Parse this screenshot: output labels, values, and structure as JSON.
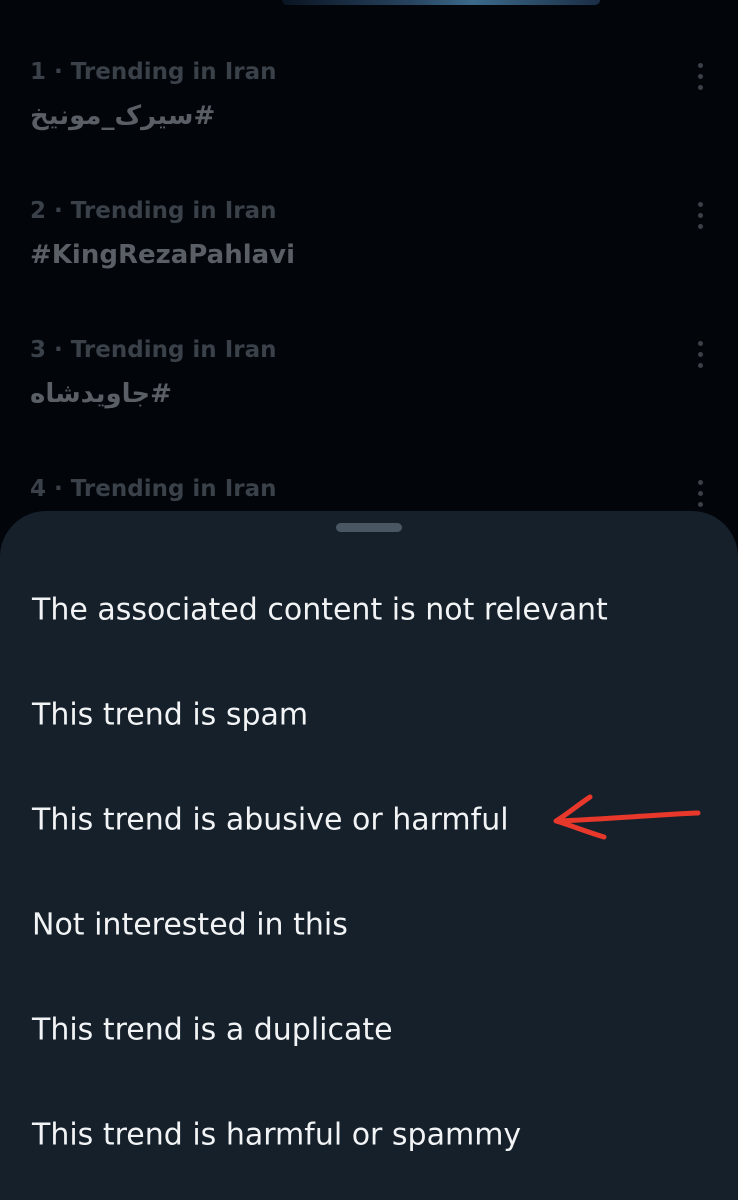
{
  "trends": [
    {
      "meta": "1 · Trending in Iran",
      "name": "#سیرک_مونیخ"
    },
    {
      "meta": "2 · Trending in Iran",
      "name": "#KingRezaPahlavi"
    },
    {
      "meta": "3 · Trending in Iran",
      "name": "#جاویدشاه"
    },
    {
      "meta": "4 · Trending in Iran",
      "name": ""
    }
  ],
  "sheet": {
    "options": [
      "The associated content is not relevant",
      "This trend is spam",
      "This trend is abusive or harmful",
      "Not interested in this",
      "This trend is a duplicate",
      "This trend is harmful or spammy"
    ]
  },
  "annotation": {
    "color": "#e8382b",
    "points_to": "This trend is abusive or harmful"
  },
  "icons": {
    "more": "more-vertical-icon",
    "grabber": "drag-handle-icon"
  }
}
